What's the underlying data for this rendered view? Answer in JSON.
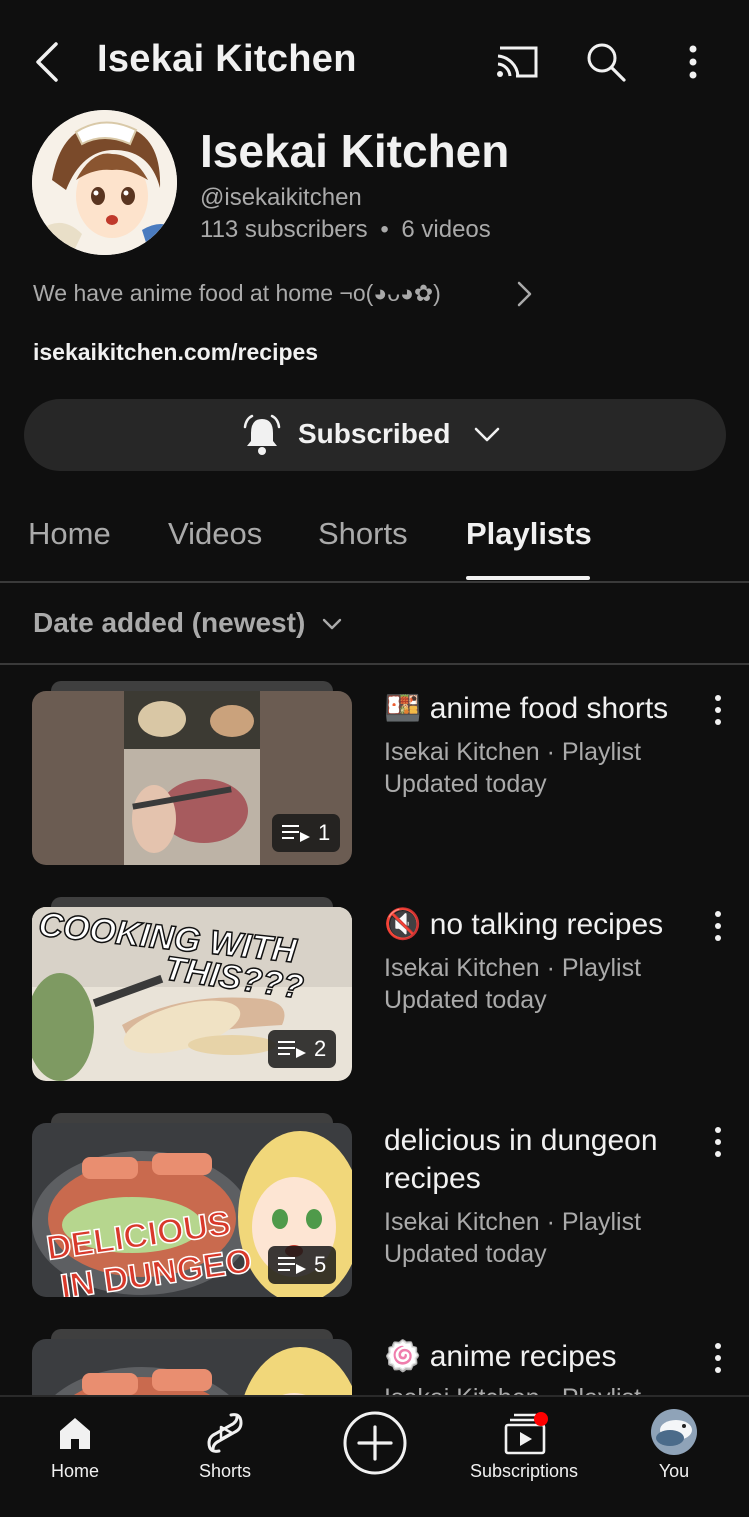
{
  "topbar": {
    "title": "Isekai Kitchen",
    "icons": [
      "back-icon",
      "cast-icon",
      "search-icon",
      "more-vert-icon"
    ]
  },
  "channel": {
    "name": "Isekai Kitchen",
    "handle": "@isekaikitchen",
    "subscribers": "113 subscribers",
    "separator": "•",
    "videos": "6 videos",
    "description": "We have anime food at home  ¬o(◕ᴗ◕✿)",
    "link": "isekaikitchen.com/recipes",
    "subscribe_label": "Subscribed"
  },
  "tabs": [
    {
      "label": "Home",
      "active": false
    },
    {
      "label": "Videos",
      "active": false
    },
    {
      "label": "Shorts",
      "active": false
    },
    {
      "label": "Playlists",
      "active": true
    }
  ],
  "sort": {
    "label": "Date added (newest)"
  },
  "playlists": [
    {
      "emoji": "🍱",
      "title": "anime food shorts",
      "meta": "Isekai Kitchen · Playlist",
      "updated": "Updated today",
      "count": "1"
    },
    {
      "emoji": "🔇",
      "title": "no talking recipes",
      "meta": "Isekai Kitchen · Playlist",
      "updated": "Updated today",
      "count": "2",
      "thumb_text_line1": "COOKING WITH",
      "thumb_text_line2": "THIS???"
    },
    {
      "emoji": "",
      "title_line1": "delicious in dungeon",
      "title_line2": "recipes",
      "meta": "Isekai Kitchen · Playlist",
      "updated": "Updated today",
      "count": "5",
      "thumb_text_line1": "DELICIOUS",
      "thumb_text_line2": "IN DUNGEO"
    },
    {
      "emoji": "🍥",
      "title": "anime recipes",
      "meta": "Isekai Kitchen · Playlist"
    }
  ],
  "bottom_nav": [
    {
      "label": "Home",
      "icon": "home-icon"
    },
    {
      "label": "Shorts",
      "icon": "shorts-icon"
    },
    {
      "label": "",
      "icon": "create-icon"
    },
    {
      "label": "Subscriptions",
      "icon": "subscriptions-icon"
    },
    {
      "label": "You",
      "icon": "you-avatar"
    }
  ],
  "colors": {
    "background": "#0f0f0f",
    "text": "#f1f1f1",
    "secondary": "#aaaaaa",
    "notification": "#ff0000"
  }
}
